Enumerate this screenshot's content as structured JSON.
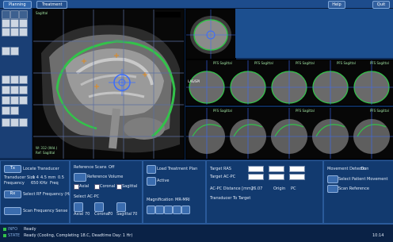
{
  "tabs": {
    "planning": "Planning",
    "treatment": "Treatment"
  },
  "topbar": {
    "btn_right1": "Help",
    "btn_right2": "Quit"
  },
  "colors": {
    "accent": "#2f66ad",
    "contour": "#33c24a",
    "panel": "#123a6f"
  },
  "left": {
    "pos_label": "Locate Transducer",
    "transducer_row": {
      "label": "Transducer Size",
      "v1": "1 4",
      "v2": "4.5 mm",
      "v3": "0.5"
    },
    "freq_row": {
      "label": "Frequency",
      "v1": "650 KHz",
      "v2": "Freq"
    },
    "ti_label": "Select RF Frequency (Hz)",
    "reset_label": "Scan Frequency Sense",
    "btn1": "Tx",
    "btn2": "Rx"
  },
  "middle": {
    "reference_label": "Reference Scans",
    "off": "Off",
    "reference_volume": "Reference Volume",
    "opts": [
      "Axial",
      "Coronal",
      "Sagittal"
    ],
    "ac_pc": "Select AC-PC",
    "views": [
      {
        "label": "Axial",
        "n": "70"
      },
      {
        "label": "Coronal",
        "n": "70"
      },
      {
        "label": "Sagittal",
        "n": "70"
      }
    ]
  },
  "plan": {
    "load_label": "Load Treatment Plan",
    "user": "Active",
    "magnification_label": "Magnification",
    "magnification_value": "MR-MRI"
  },
  "coords": {
    "rows": [
      {
        "label": "Target RAS"
      },
      {
        "label": "Target AC-PC"
      }
    ],
    "ac_pc_dist": {
      "label": "AC-PC Distance [mm]",
      "value": "26.07",
      "origin_label": "Origin",
      "origin_value": "PC"
    },
    "transducer_target": "Transducer To Target"
  },
  "movement": {
    "label": "Movement Detection",
    "state": "On",
    "btn1": "Select Patient Movement",
    "btn2": "Scan Reference"
  },
  "viewport_text": {
    "main_tl": "Sagittal",
    "main_bl1": "W: 312 (Wid.)",
    "main_bl2": "Ref: Sagittal",
    "strip_labels": [
      "PFS Sagittal",
      "PFS Sagittal",
      "PFS Sagittal",
      "PFS Sagittal",
      "PFS Sagittal"
    ],
    "strip_small": "LAS/SPI"
  },
  "status": {
    "line1_key": "INFO",
    "line1": "Ready",
    "line2_key": "STATE",
    "line2": "Ready (Cooling, Completing 18.C, Deadtime Day: 1 Hr)",
    "time": "10:14"
  }
}
